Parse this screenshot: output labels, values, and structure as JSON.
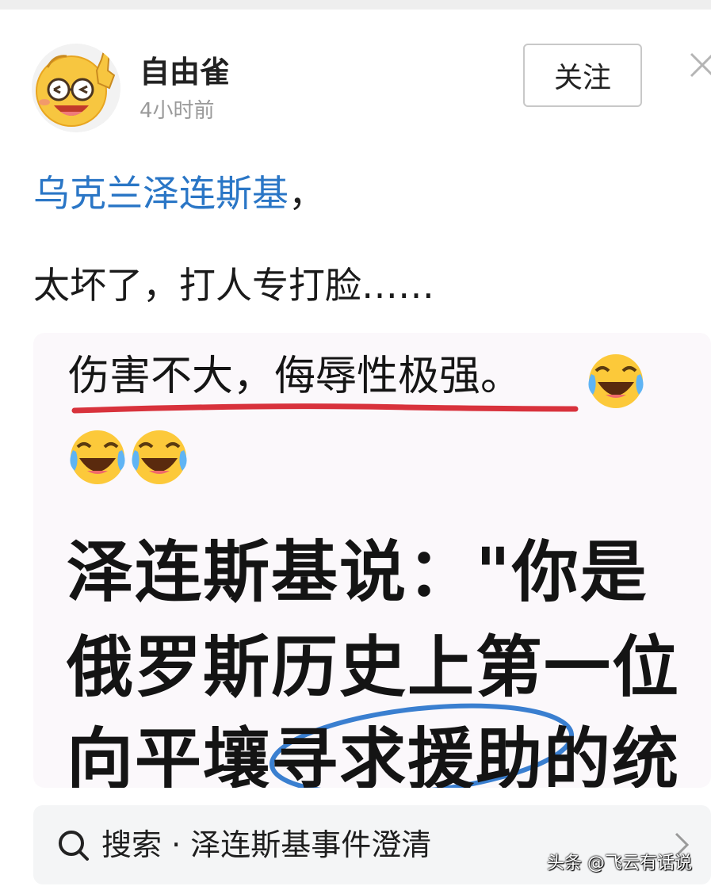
{
  "post": {
    "author": "自由雀",
    "time": "4小时前",
    "follow_label": "关注",
    "topic_link": "乌克兰泽连斯基",
    "topic_suffix": "，",
    "body_line": "太坏了，打人专打脸……"
  },
  "meme": {
    "caption": "伤害不大，侮辱性极强。",
    "big_lines": [
      "泽连斯基说：\"你是",
      "俄罗斯历史上第一位",
      "向平壤寻求援助的统"
    ],
    "emoji_icon": "laughing-crying-emoji-icon"
  },
  "search": {
    "label": "搜索 · 泽连斯基事件澄清"
  },
  "watermark": "头条 @飞云有话说",
  "colors": {
    "link": "#2a76c6",
    "underline": "#d8323c",
    "circle": "#3a7fd0",
    "search_bg": "#f4f5f6"
  }
}
